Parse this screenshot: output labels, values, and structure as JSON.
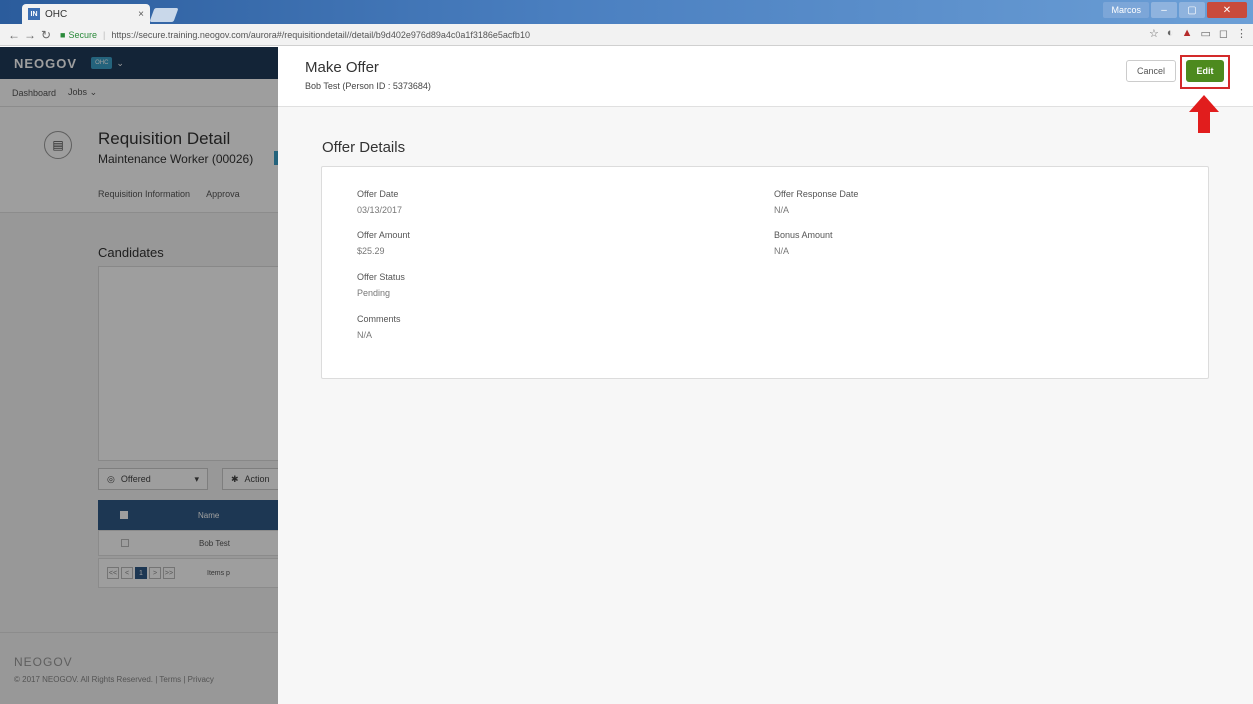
{
  "browser": {
    "tab_title": "OHC",
    "tab_favicon": "IN",
    "tab_close": "×",
    "url_secure_label": "Secure",
    "url": "https://secure.training.neogov.com/aurora#/requisitiondetail//detail/b9d402e976d89a4c0a1f3186e5acfb10",
    "user_label": "Marcos",
    "minimize": "–",
    "maximize": "▢",
    "close": "✕"
  },
  "app": {
    "logo": "NEOGOV",
    "product_badge": "OHC",
    "nav": {
      "dashboard": "Dashboard",
      "jobs": "Jobs"
    },
    "requisition": {
      "title": "Requisition Detail",
      "subtitle": "Maintenance Worker (00026)",
      "tab_info": "Requisition Information",
      "tab_approvals": "Approva"
    },
    "candidates": {
      "heading": "Candidates",
      "filter_label": "Offered",
      "actions_label": "Action",
      "column_name": "Name",
      "rows": [
        {
          "name": "Bob Test"
        }
      ],
      "pager": {
        "first": "<<",
        "prev": "<",
        "current": "1",
        "next": ">",
        "last": ">>",
        "items_label": "Items p"
      }
    },
    "footer": {
      "logo": "NEOGOV",
      "copyright": "© 2017 NEOGOV. All Rights Reserved. | Terms | Privacy"
    }
  },
  "panel": {
    "title": "Make Offer",
    "subtitle": "Bob Test (Person ID : 5373684)",
    "cancel_label": "Cancel",
    "edit_label": "Edit",
    "section_title": "Offer Details",
    "fields": {
      "offer_date_label": "Offer Date",
      "offer_date_value": "03/13/2017",
      "offer_response_date_label": "Offer Response Date",
      "offer_response_date_value": "N/A",
      "offer_amount_label": "Offer Amount",
      "offer_amount_value": "$25.29",
      "bonus_amount_label": "Bonus Amount",
      "bonus_amount_value": "N/A",
      "offer_status_label": "Offer Status",
      "offer_status_value": "Pending",
      "comments_label": "Comments",
      "comments_value": "N/A"
    }
  },
  "colors": {
    "edit_button": "#4d8a1e",
    "highlight": "#d32a2a",
    "header_navy": "#1f3a5a"
  }
}
